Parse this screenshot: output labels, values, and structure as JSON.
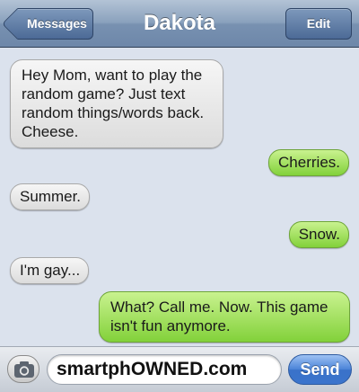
{
  "navbar": {
    "back_label": "Messages",
    "title": "Dakota",
    "edit_label": "Edit"
  },
  "messages": [
    {
      "direction": "incoming",
      "text": "Hey Mom, want to play the random game? Just text random things/words back. Cheese."
    },
    {
      "direction": "outgoing",
      "text": "Cherries."
    },
    {
      "direction": "incoming",
      "text": "Summer."
    },
    {
      "direction": "outgoing",
      "text": "Snow."
    },
    {
      "direction": "incoming",
      "text": "I'm gay..."
    },
    {
      "direction": "outgoing",
      "text": "What? Call me. Now. This game isn't fun anymore."
    }
  ],
  "composer": {
    "camera_icon": "camera-icon",
    "field_text": "smartphOWNED.com",
    "send_label": "Send"
  },
  "colors": {
    "incoming_bubble": "#e8e8e8",
    "outgoing_bubble": "#9be05a",
    "navbar": "#7891b1",
    "send_button": "#3b74cc",
    "background": "#dbe2ed"
  }
}
